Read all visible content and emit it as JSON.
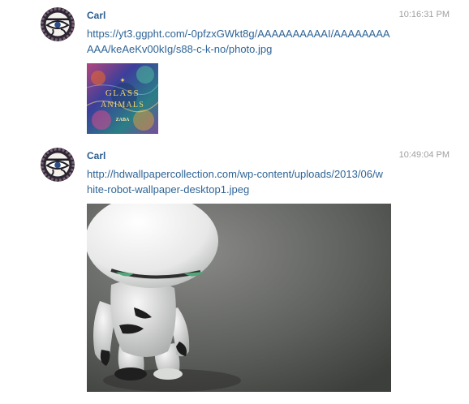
{
  "messages": [
    {
      "author": "Carl",
      "timestamp": "10:16:31 PM",
      "link": "https://yt3.ggpht.com/-0pfzxGWkt8g/AAAAAAAAAAI/AAAAAAAAAAA/keAeKv00kIg/s88-c-k-no/photo.jpg",
      "image_text": {
        "line1": "GLASS",
        "line2": "ANIMALS",
        "line3": "ZABA"
      }
    },
    {
      "author": "Carl",
      "timestamp": "10:49:04 PM",
      "link": "http://hdwallpapercollection.com/wp-content/uploads/2013/06/white-robot-wallpaper-desktop1.jpeg"
    }
  ],
  "colors": {
    "author": "#2a5d8f",
    "link": "#2f6496",
    "timestamp": "#a0a0a0"
  }
}
